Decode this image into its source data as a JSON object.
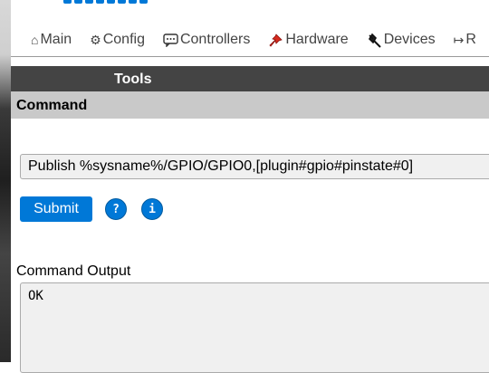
{
  "nav": {
    "items": [
      {
        "label": "Main",
        "icon": "home-icon",
        "glyph": "⌂"
      },
      {
        "label": "Config",
        "icon": "gear-icon",
        "glyph": "⚙"
      },
      {
        "label": "Controllers",
        "icon": "speech-bubble-icon",
        "glyph": "💬"
      },
      {
        "label": "Hardware",
        "icon": "pushpin-icon",
        "glyph": "📌"
      },
      {
        "label": "Devices",
        "icon": "plug-icon",
        "glyph": "🔌"
      },
      {
        "label": "R",
        "icon": "rules-arrow-icon",
        "glyph": "↦"
      }
    ]
  },
  "tools": {
    "title": "Tools"
  },
  "command": {
    "section_title": "Command",
    "input_value": "Publish %sysname%/GPIO/GPIO0,[plugin#gpio#pinstate#0]",
    "submit_label": "Submit",
    "help_label": "?",
    "info_label": "i"
  },
  "output": {
    "label": "Command Output",
    "value": "OK"
  },
  "colors": {
    "accent": "#0078d7",
    "header_dark": "#444444",
    "section_gray": "#c9c9c9"
  }
}
